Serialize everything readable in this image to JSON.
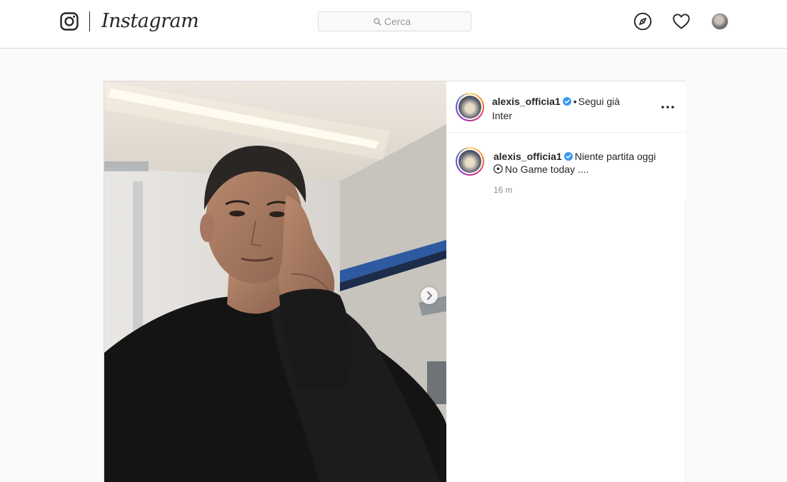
{
  "nav": {
    "brand": "Instagram",
    "search_placeholder": "Cerca",
    "icons": [
      "instagram-logo-icon",
      "search-icon",
      "explore-compass-icon",
      "heart-icon",
      "profile-avatar"
    ]
  },
  "post": {
    "author": {
      "username": "alexis_officia1",
      "verified": true,
      "separator": "•",
      "follow_status": "Segui già",
      "location": "Inter"
    },
    "caption": {
      "username": "alexis_officia1",
      "text_line1": "Niente partita oggi",
      "emoji_name": "soccer-ball-icon",
      "text_line2": "No Game today ....",
      "time": "16 m"
    },
    "carousel": {
      "next_icon": "chevron-right-icon"
    }
  },
  "colors": {
    "text": "#262626",
    "muted": "#8e8e8e",
    "border": "#dbdbdb",
    "background": "#fafafa",
    "verified_blue": "#3897f0"
  }
}
